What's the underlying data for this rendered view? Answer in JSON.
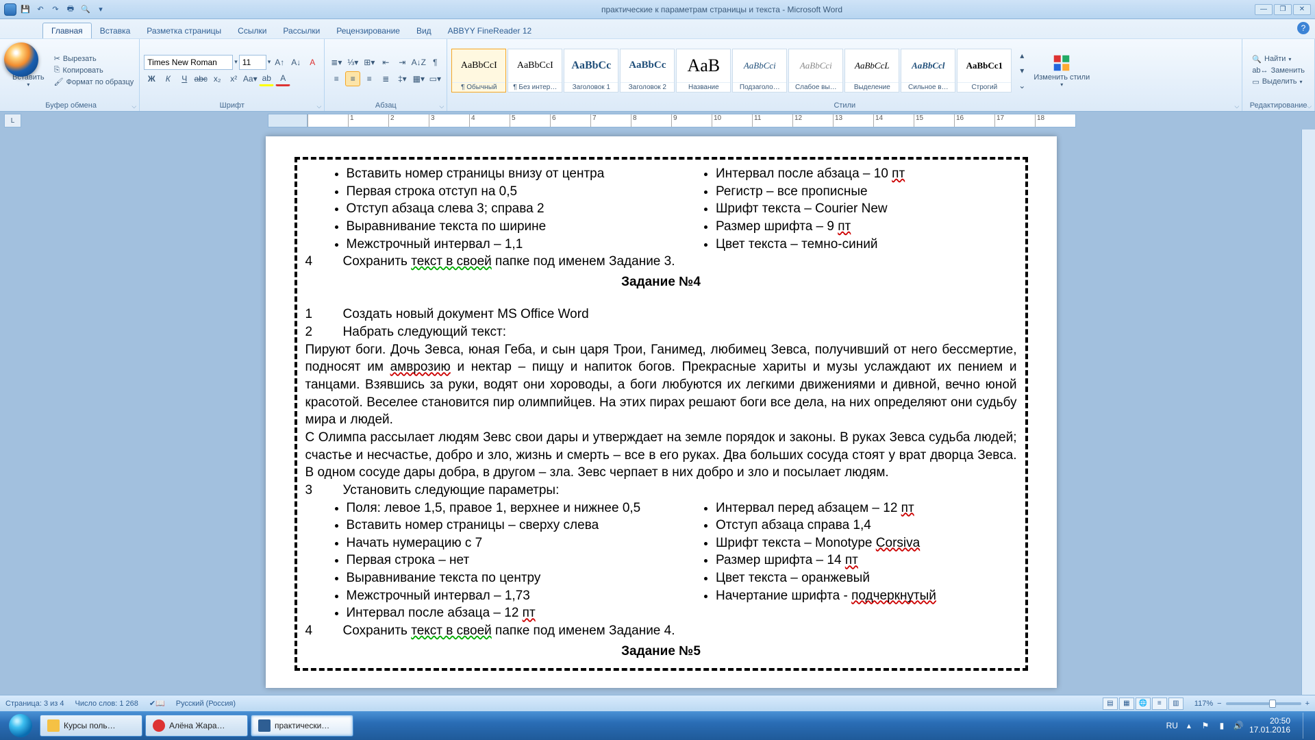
{
  "title": "практические к параметрам страницы и текста - Microsoft Word",
  "qat": {
    "save": "💾",
    "undo": "↶",
    "redo": "↷",
    "print": "🖶",
    "preview": "🔍",
    "more": "▾"
  },
  "tabs": [
    "Главная",
    "Вставка",
    "Разметка страницы",
    "Ссылки",
    "Рассылки",
    "Рецензирование",
    "Вид",
    "ABBYY FineReader 12"
  ],
  "clipboard": {
    "group": "Буфер обмена",
    "paste": "Вставить",
    "cut": "Вырезать",
    "copy": "Копировать",
    "format_painter": "Формат по образцу"
  },
  "font": {
    "group": "Шрифт",
    "name": "Times New Roman",
    "size": "11"
  },
  "paragraph": {
    "group": "Абзац"
  },
  "styles": {
    "group": "Стили",
    "change": "Изменить стили",
    "items": [
      {
        "preview": "AaBbCcI",
        "label": "¶ Обычный",
        "size": "14px",
        "color": "#000"
      },
      {
        "preview": "AaBbCcI",
        "label": "¶ Без интер…",
        "size": "14px",
        "color": "#000"
      },
      {
        "preview": "AaBbCc",
        "label": "Заголовок 1",
        "size": "16px",
        "color": "#1f4e79",
        "bold": true
      },
      {
        "preview": "AaBbCc",
        "label": "Заголовок 2",
        "size": "15px",
        "color": "#1f4e79",
        "bold": true
      },
      {
        "preview": "AaB",
        "label": "Название",
        "size": "26px",
        "color": "#000"
      },
      {
        "preview": "AaBbCci",
        "label": "Подзаголо…",
        "size": "13px",
        "color": "#1f4e79",
        "italic": true
      },
      {
        "preview": "AaBbCci",
        "label": "Слабое вы…",
        "size": "13px",
        "color": "#888",
        "italic": true
      },
      {
        "preview": "AaBbCcL",
        "label": "Выделение",
        "size": "13px",
        "color": "#000",
        "italic": true
      },
      {
        "preview": "AaBbCcl",
        "label": "Сильное в…",
        "size": "13px",
        "color": "#1f4e79",
        "italic": true,
        "bold": true
      },
      {
        "preview": "AaBbCc1",
        "label": "Строгий",
        "size": "13px",
        "color": "#000",
        "bold": true
      }
    ]
  },
  "editing": {
    "group": "Редактирование",
    "find": "Найти",
    "replace": "Заменить",
    "select": "Выделить"
  },
  "ruler_numbers": [
    " ",
    "1",
    "2",
    "3",
    "4",
    "5",
    "6",
    "7",
    "8",
    "9",
    "10",
    "11",
    "12",
    "13",
    "14",
    "15",
    "16",
    "17",
    "18"
  ],
  "doc": {
    "left1": [
      "Вставить номер страницы внизу от центра",
      "Первая строка отступ на 0,5",
      "Отступ абзаца слева  3; справа  2",
      "Выравнивание текста по ширине",
      "Межстрочный интервал – 1,1"
    ],
    "right1": [
      "Интервал после абзаца – 10 ",
      "Регистр – все прописные",
      "Шрифт текста – Courier New",
      "Размер шрифта – 9 ",
      "Цвет текста – темно-синий"
    ],
    "pt": "пт",
    "save3_num": "4",
    "save3": "Сохранить текст в своей папке под именем Задание 3.",
    "save3_sq": "текст  в  своей",
    "title4": "Задание №4",
    "l1_num": "1",
    "l1": "Создать новый документ MS Office Word",
    "l2_num": "2",
    "l2": "Набрать следующий текст:",
    "para1a": "Пируют боги. Дочь Зевса, юная Геба, и сын царя Трои, Ганимед, любимец Зевса, получивший от него бессмертие, подносят им ",
    "para1_amb": "амврозию",
    "para1b": " и нектар – пищу и напиток богов. Прекрасные хариты и музы услаждают их пением и танцами. Взявшись за руки, водят они хороводы, а боги любуются их легкими движениями и дивной, вечно юной красотой. Веселее становится пир олимпийцев. На этих пирах решают боги все дела, на них определяют они судьбу мира и людей.",
    "para2": "С Олимпа рассылает людям Зевс свои дары и утверждает на земле порядок и законы. В руках Зевса судьба людей; счастье и несчастье, добро и зло, жизнь и смерть – все в его руках. Два больших сосуда стоят у врат дворца Зевса. В одном сосуде дары добра, в другом – зла. Зевс черпает в них добро и зло и посылает людям.",
    "l3_num": "3",
    "l3": "Установить следующие параметры:",
    "left2_first": "Поля: левое  1,5, правое  1, верхнее и нижнее  0,5",
    "left2": [
      "Вставить номер страницы – сверху слева",
      "Начать нумерацию с 7",
      "Первая строка – нет",
      "Выравнивание текста по центру",
      "Межстрочный интервал – 1,73",
      "Интервал после абзаца – 12 "
    ],
    "right2": [
      "Интервал перед абзацем – 12 ",
      "Отступ абзаца справа  1,4",
      "Шрифт текста – Monotype ",
      "Размер шрифта – 14 ",
      "Цвет текста – оранжевый",
      "Начертание шрифта - "
    ],
    "corsiva": "Corsiva",
    "underlined": "подчеркнутый",
    "save4_num": "4",
    "save4": "Сохранить текст в своей папке под именем Задание 4.",
    "title5": "Задание №5"
  },
  "status": {
    "page": "Страница: 3 из 4",
    "words": "Число слов: 1 268",
    "lang": "Русский (Россия)",
    "zoom": "117%"
  },
  "taskbar": {
    "items": [
      {
        "label": "Курсы поль…",
        "icon": "fld"
      },
      {
        "label": "Алёна Жара…",
        "icon": "ya"
      },
      {
        "label": "практически…",
        "icon": "wd",
        "active": true
      }
    ],
    "lang": "RU",
    "time": "20:50",
    "date": "17.01.2016"
  }
}
